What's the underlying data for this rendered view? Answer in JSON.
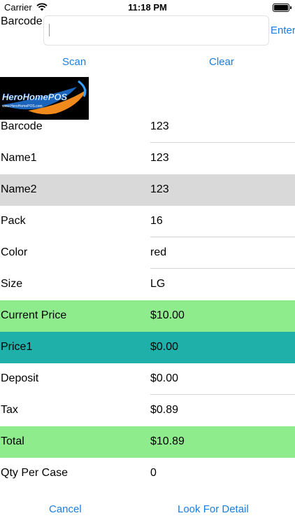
{
  "status_bar": {
    "carrier": "Carrier",
    "time": "11:18 PM"
  },
  "search": {
    "label": "Barcode",
    "value": "",
    "enter_label": "Enter",
    "scan_label": "Scan",
    "clear_label": "Clear"
  },
  "logo": {
    "brand": "HeroHomePOS",
    "url": "www.HeroHomePOS.com"
  },
  "details": [
    {
      "key": "Barcode",
      "value": "123",
      "style": "sep"
    },
    {
      "key": "Name1",
      "value": "123",
      "style": "plain"
    },
    {
      "key": "Name2",
      "value": "123",
      "style": "gray"
    },
    {
      "key": "Pack",
      "value": "16",
      "style": "sep"
    },
    {
      "key": "Color",
      "value": "red",
      "style": "sep"
    },
    {
      "key": "Size",
      "value": "LG",
      "style": "plain"
    },
    {
      "key": "Current Price",
      "value": "$10.00",
      "style": "green"
    },
    {
      "key": "Price1",
      "value": "$0.00",
      "style": "teal"
    },
    {
      "key": "Deposit",
      "value": "$0.00",
      "style": "sep"
    },
    {
      "key": "Tax",
      "value": "$0.89",
      "style": "plain"
    },
    {
      "key": "Total",
      "value": "$10.89",
      "style": "green"
    },
    {
      "key": "Qty Per Case",
      "value": "0",
      "style": "plain"
    }
  ],
  "footer": {
    "cancel_label": "Cancel",
    "detail_label": "Look For Detail"
  },
  "colors": {
    "accent": "#1a7ee0",
    "row_gray": "#d9d9d9",
    "row_green": "#8eec8c",
    "row_teal": "#20b0aa"
  }
}
